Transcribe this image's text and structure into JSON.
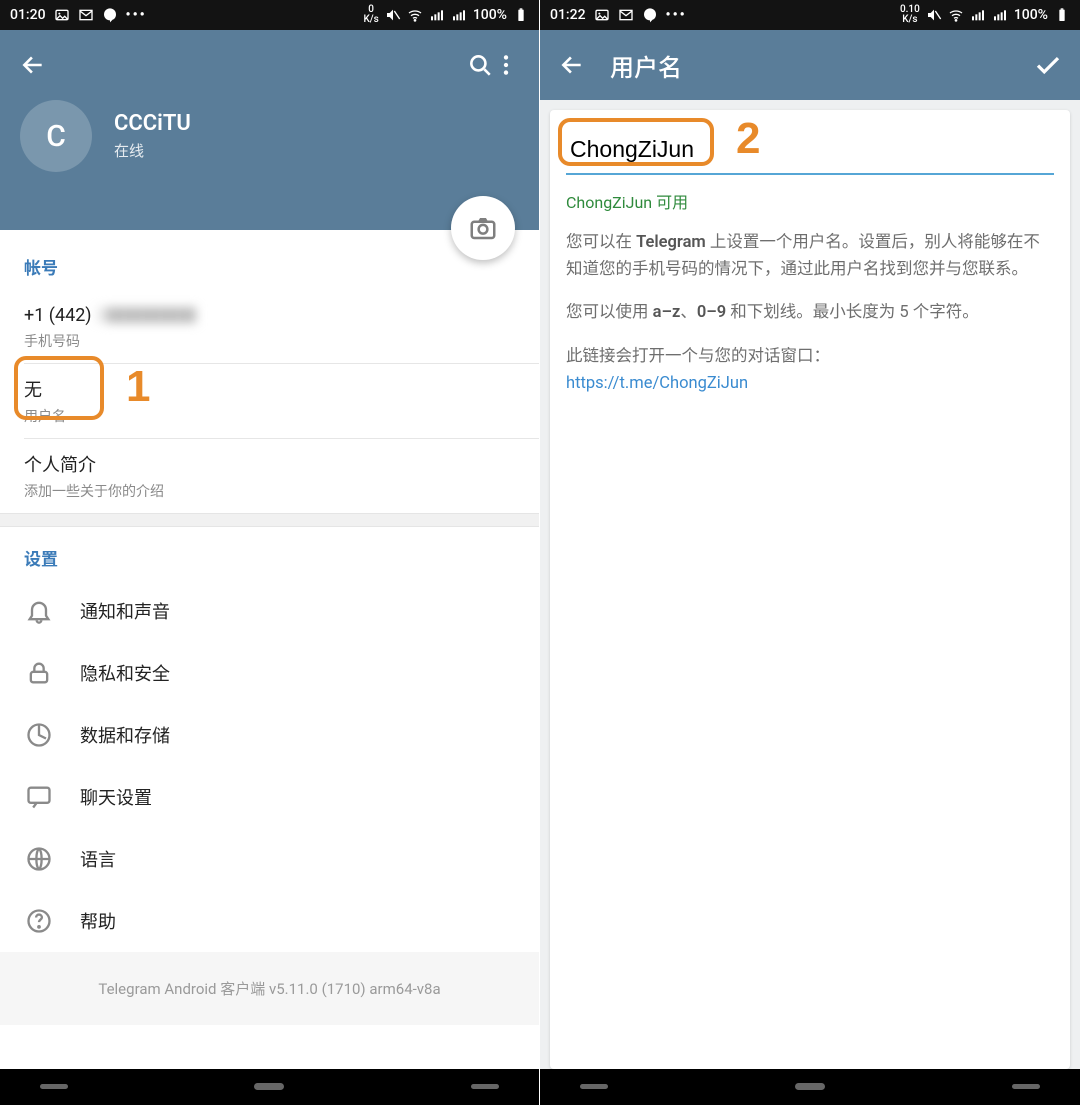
{
  "left": {
    "statusbar": {
      "time": "01:20",
      "speed_top": "0",
      "speed_unit": "K/s",
      "battery": "100%"
    },
    "profile": {
      "avatar_letter": "C",
      "name": "CCCiTU",
      "status": "在线"
    },
    "account": {
      "header": "帐号",
      "phone": "+1 (442)",
      "phone_rest_blurred": "2▇▇▇▇▇",
      "phone_label": "手机号码",
      "username_value": "无",
      "username_label": "用户名",
      "bio_title": "个人简介",
      "bio_hint": "添加一些关于你的介绍"
    },
    "settings": {
      "header": "设置",
      "items": [
        {
          "id": "notifications",
          "label": "通知和声音"
        },
        {
          "id": "privacy",
          "label": "隐私和安全"
        },
        {
          "id": "data",
          "label": "数据和存储"
        },
        {
          "id": "chat",
          "label": "聊天设置"
        },
        {
          "id": "language",
          "label": "语言"
        },
        {
          "id": "help",
          "label": "帮助"
        }
      ]
    },
    "footer": "Telegram Android 客户端 v5.11.0 (1710) arm64-v8a",
    "anno": "1"
  },
  "right": {
    "statusbar": {
      "time": "01:22",
      "speed_top": "0.10",
      "speed_unit": "K/s",
      "battery": "100%"
    },
    "title": "用户名",
    "username_input": "ChongZiJun",
    "available_text": "ChongZiJun 可用",
    "desc1_a": "您可以在 ",
    "desc1_b": "Telegram",
    "desc1_c": " 上设置一个用户名。设置后，别人将能够在不知道您的手机号码的情况下，通过此用户名找到您并与您联系。",
    "desc2_a": "您可以使用 ",
    "desc2_b": "a–z",
    "desc2_c": "、",
    "desc2_d": "0–9",
    "desc2_e": " 和下划线。最小长度为 5 个字符。",
    "desc3": "此链接会打开一个与您的对话窗口：",
    "link": "https://t.me/ChongZiJun",
    "anno": "2"
  }
}
